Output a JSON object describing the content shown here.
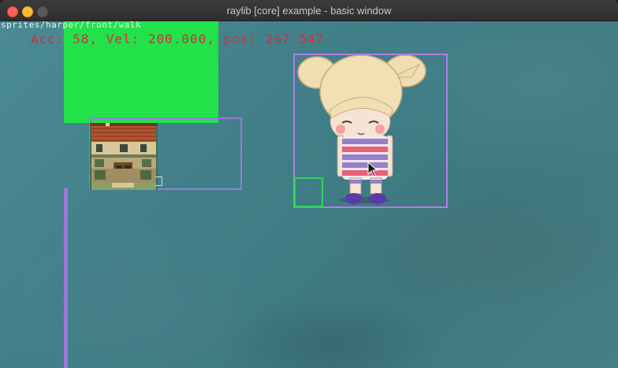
{
  "window": {
    "title": "raylib [core] example - basic window"
  },
  "hud": {
    "path_text": "sprites/harper/front/walk",
    "stats_text": "Acc: 58, Vel: 200.000, pos: 267.547"
  },
  "colors": {
    "titlebar_close": "#fe5f57",
    "titlebar_minimize": "#febc2e",
    "titlebar_zoom_disabled": "#5a5a5a",
    "stats_text": "#c8323e",
    "green_rect": "#22e24a",
    "bounding_box": "#b07ee8",
    "hitbox": "#2fd35a"
  },
  "icons": {
    "close": "close-traffic-light-icon",
    "minimize": "minimize-traffic-light-icon",
    "zoom": "zoom-traffic-light-icon",
    "cursor": "arrow-cursor-icon"
  }
}
